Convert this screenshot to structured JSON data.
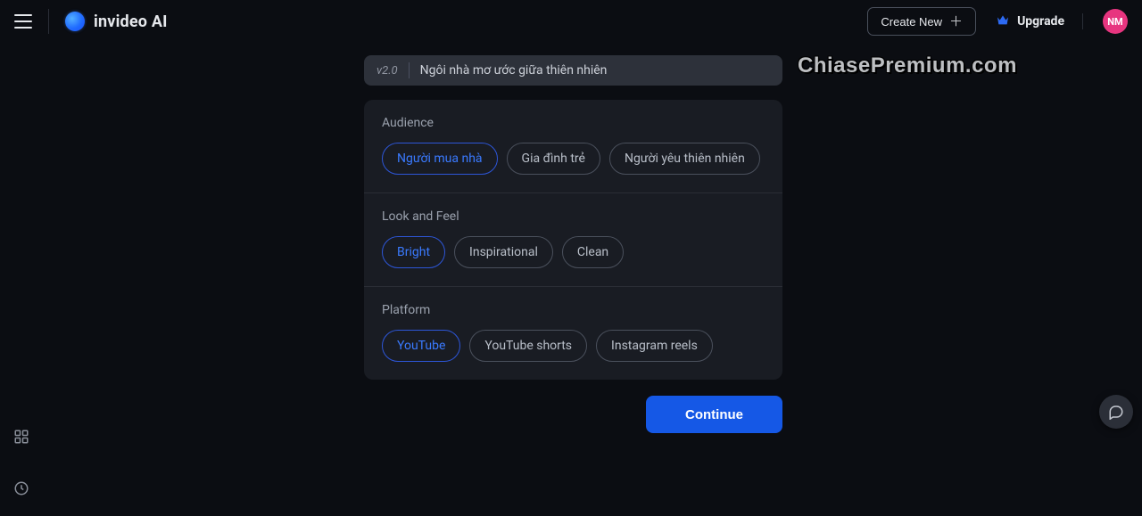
{
  "header": {
    "brand": "invideo AI",
    "create_label": "Create New",
    "upgrade_label": "Upgrade",
    "avatar_initials": "NM"
  },
  "prompt": {
    "version": "v2.0",
    "text": "Ngôi nhà mơ ước giữa thiên nhiên"
  },
  "sections": {
    "audience": {
      "title": "Audience",
      "options": [
        "Người mua nhà",
        "Gia đình trẻ",
        "Người yêu thiên nhiên"
      ],
      "selected": "Người mua nhà"
    },
    "look": {
      "title": "Look and Feel",
      "options": [
        "Bright",
        "Inspirational",
        "Clean"
      ],
      "selected": "Bright"
    },
    "platform": {
      "title": "Platform",
      "options": [
        "YouTube",
        "YouTube shorts",
        "Instagram reels"
      ],
      "selected": "YouTube"
    }
  },
  "actions": {
    "continue": "Continue"
  },
  "watermark": "ChiasePremium.com"
}
